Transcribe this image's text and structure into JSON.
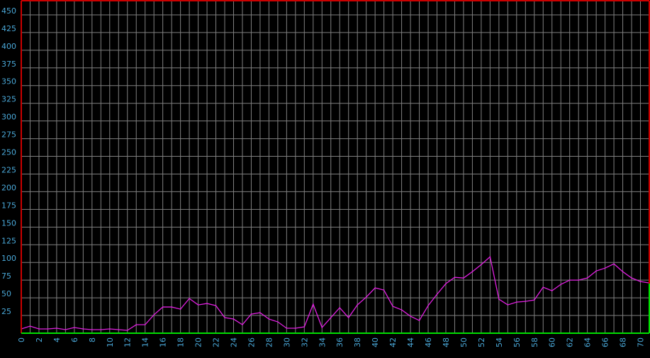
{
  "chart_data": {
    "type": "line",
    "title": "",
    "xlabel": "",
    "ylabel": "",
    "xlim": [
      0,
      71
    ],
    "ylim": [
      0,
      470
    ],
    "grid": true,
    "x_tick_labels": [
      "0",
      "2",
      "4",
      "6",
      "8",
      "10",
      "12",
      "14",
      "16",
      "18",
      "20",
      "22",
      "24",
      "26",
      "28",
      "30",
      "32",
      "34",
      "36",
      "38",
      "40",
      "42",
      "44",
      "46",
      "48",
      "50",
      "52",
      "54",
      "56",
      "58",
      "60",
      "62",
      "64",
      "66",
      "68",
      "70"
    ],
    "y_tick_labels": [
      "25",
      "50",
      "75",
      "100",
      "125",
      "150",
      "175",
      "200",
      "225",
      "250",
      "275",
      "300",
      "325",
      "350",
      "375",
      "400",
      "425",
      "450"
    ],
    "colors": {
      "background": "#000000",
      "grid": "#808080",
      "line": "#e020e0",
      "x_axis": "#00e000",
      "frame": "#cc0000",
      "tick_text": "#4aa8d8"
    },
    "series": [
      {
        "x": [
          0,
          1,
          2,
          3,
          4,
          5,
          6,
          7,
          8,
          9,
          10,
          11,
          12,
          13,
          14,
          15,
          16,
          17,
          18,
          19,
          20,
          21,
          22,
          23,
          24,
          25,
          26,
          27,
          28,
          29,
          30,
          31,
          32,
          33,
          34,
          35,
          36,
          37,
          38,
          39,
          40,
          41,
          42,
          43,
          44,
          45,
          46,
          47,
          48,
          49,
          50,
          51,
          52,
          53,
          54,
          55,
          56,
          57,
          58,
          59,
          60,
          61,
          62,
          63,
          64,
          65,
          66,
          67,
          68,
          69,
          70,
          71
        ],
        "values": [
          6,
          10,
          6,
          6,
          7,
          5,
          8,
          6,
          5,
          5,
          6,
          5,
          4,
          12,
          12,
          26,
          37,
          37,
          34,
          49,
          40,
          42,
          39,
          22,
          20,
          12,
          27,
          29,
          20,
          16,
          7,
          7,
          9,
          41,
          8,
          22,
          36,
          22,
          40,
          51,
          64,
          61,
          38,
          33,
          24,
          18,
          39,
          55,
          70,
          79,
          78,
          87,
          97,
          108,
          48,
          40,
          44,
          45,
          47,
          65,
          60,
          69,
          75,
          75,
          78,
          88,
          92,
          98,
          87,
          78,
          73,
          71
        ]
      }
    ]
  }
}
